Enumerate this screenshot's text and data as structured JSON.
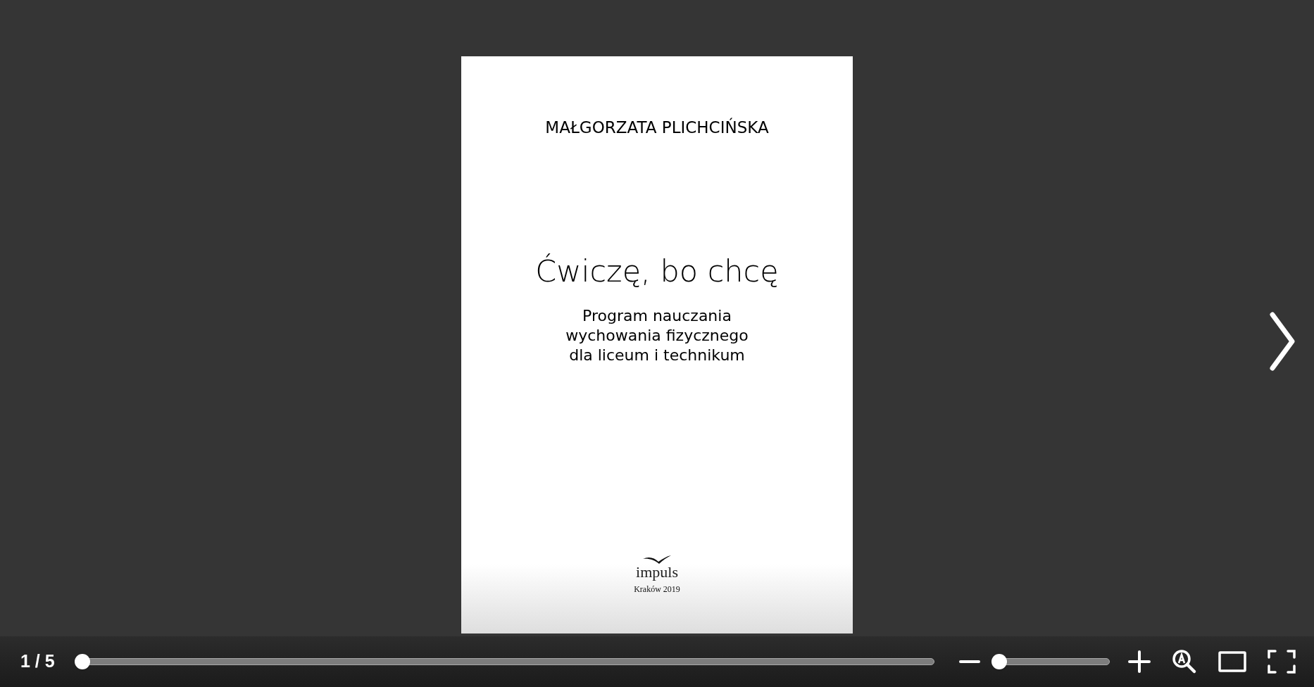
{
  "page": {
    "author": "MAŁGORZATA PLICHCIŃSKA",
    "title": "Ćwiczę, bo chcę",
    "subtitle": "Program nauczania\nwychowania fizycznego\ndla liceum i technikum",
    "publisher": "impuls",
    "imprint": "Kraków 2019"
  },
  "toolbar": {
    "page_counter": "1 / 5",
    "progress": {
      "level": 0
    },
    "zoom": {
      "level": 0
    }
  }
}
